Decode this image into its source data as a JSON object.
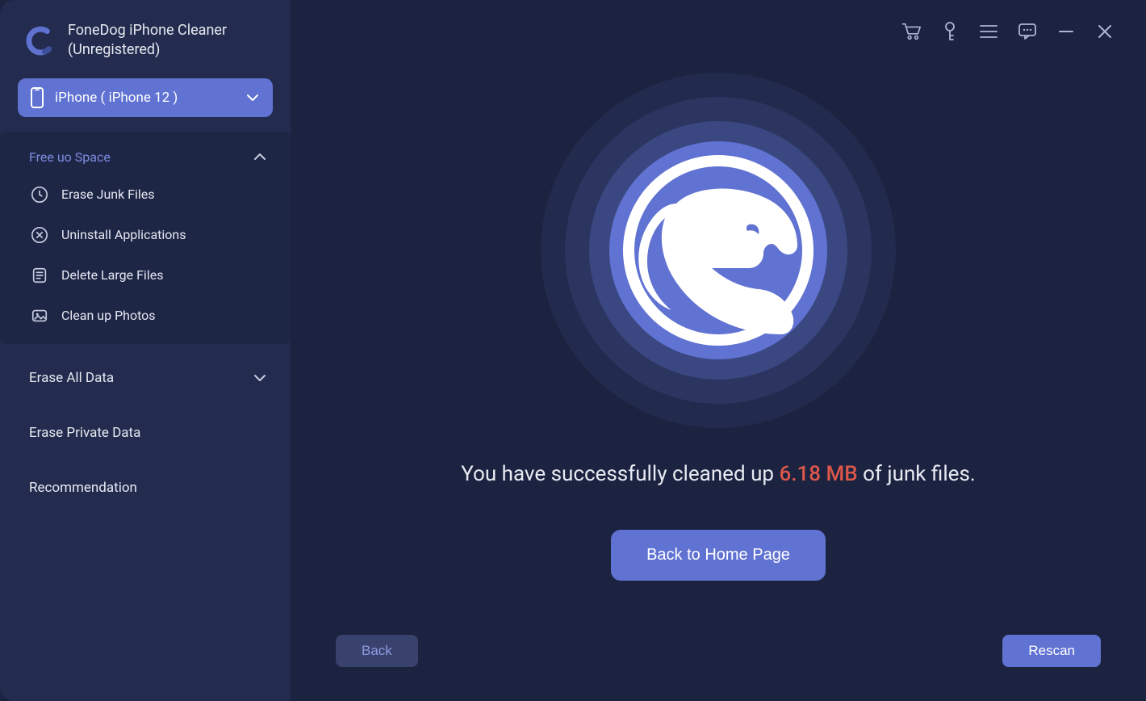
{
  "app": {
    "title_line1": "FoneDog iPhone  Cleaner",
    "title_line2": "(Unregistered)"
  },
  "device": {
    "label": "iPhone ( iPhone 12 )"
  },
  "sidebar": {
    "section_free_up": {
      "title": "Free uo Space",
      "items": [
        {
          "id": "erase-junk",
          "label": "Erase Junk Files"
        },
        {
          "id": "uninstall",
          "label": "Uninstall Applications"
        },
        {
          "id": "large-files",
          "label": "Delete Large Files"
        },
        {
          "id": "clean-photos",
          "label": "Clean up Photos"
        }
      ]
    },
    "groups": [
      {
        "id": "erase-all",
        "label": "Erase All Data",
        "expandable": true
      },
      {
        "id": "erase-private",
        "label": "Erase Private Data",
        "expandable": false
      },
      {
        "id": "recommend",
        "label": "Recommendation",
        "expandable": false
      }
    ]
  },
  "result": {
    "prefix": "You have successfully cleaned up ",
    "size": "6.18 MB",
    "suffix": " of junk files."
  },
  "buttons": {
    "home": "Back to Home Page",
    "back": "Back",
    "rescan": "Rescan"
  },
  "titlebar_icons": [
    "cart",
    "key",
    "menu",
    "feedback",
    "minimize",
    "close"
  ]
}
